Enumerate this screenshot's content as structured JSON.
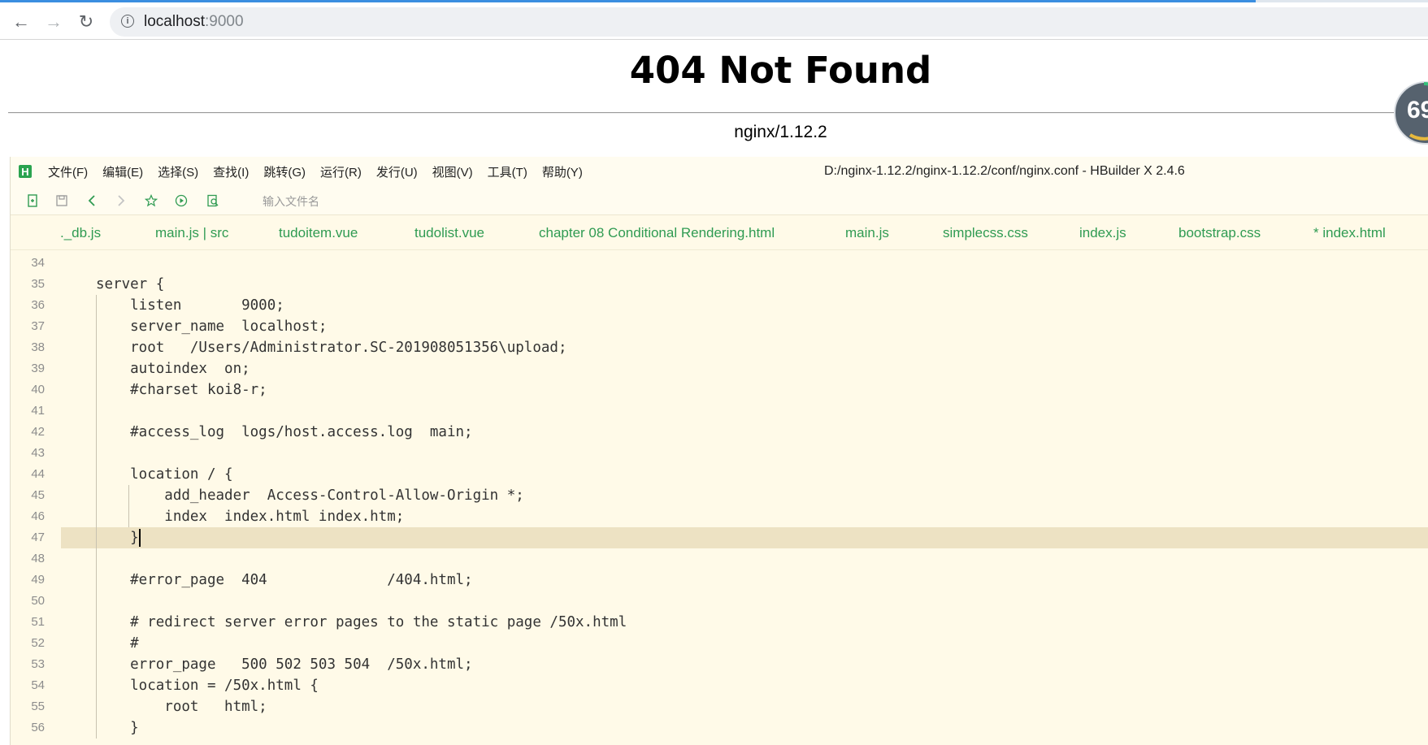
{
  "browser": {
    "url_host": "localhost",
    "url_port": ":9000",
    "back_icon": "←",
    "forward_icon": "→",
    "reload_icon": "↻",
    "info_icon": "i"
  },
  "page": {
    "heading": "404 Not Found",
    "server": "nginx/1.12.2",
    "badge": "69"
  },
  "hbuilder": {
    "logo": "H",
    "title": "D:/nginx-1.12.2/nginx-1.12.2/conf/nginx.conf - HBuilder X 2.4.6",
    "menus": [
      "文件(F)",
      "编辑(E)",
      "选择(S)",
      "查找(I)",
      "跳转(G)",
      "运行(R)",
      "发行(U)",
      "视图(V)",
      "工具(T)",
      "帮助(Y)"
    ],
    "file_placeholder": "输入文件名",
    "tabs": [
      "._db.js",
      "main.js | src",
      "tudoitem.vue",
      "tudolist.vue",
      "chapter 08 Conditional Rendering.html",
      "main.js",
      "simplecss.css",
      "index.js",
      "bootstrap.css",
      "* index.html"
    ],
    "active_line": 47,
    "code_lines": [
      {
        "n": "34",
        "text": ""
      },
      {
        "n": "35",
        "text": "server {"
      },
      {
        "n": "36",
        "text": "    listen       9000;"
      },
      {
        "n": "37",
        "text": "    server_name  localhost;"
      },
      {
        "n": "38",
        "text": "    root   /Users/Administrator.SC-201908051356\\upload;"
      },
      {
        "n": "39",
        "text": "    autoindex  on;"
      },
      {
        "n": "40",
        "text": "    #charset koi8-r;"
      },
      {
        "n": "41",
        "text": ""
      },
      {
        "n": "42",
        "text": "    #access_log  logs/host.access.log  main;"
      },
      {
        "n": "43",
        "text": ""
      },
      {
        "n": "44",
        "text": "    location / {"
      },
      {
        "n": "45",
        "text": "        add_header  Access-Control-Allow-Origin *;"
      },
      {
        "n": "46",
        "text": "        index  index.html index.htm;"
      },
      {
        "n": "47",
        "text": "    }"
      },
      {
        "n": "48",
        "text": ""
      },
      {
        "n": "49",
        "text": "    #error_page  404              /404.html;"
      },
      {
        "n": "50",
        "text": ""
      },
      {
        "n": "51",
        "text": "    # redirect server error pages to the static page /50x.html"
      },
      {
        "n": "52",
        "text": "    #"
      },
      {
        "n": "53",
        "text": "    error_page   500 502 503 504  /50x.html;"
      },
      {
        "n": "54",
        "text": "    location = /50x.html {"
      },
      {
        "n": "55",
        "text": "        root   html;"
      },
      {
        "n": "56",
        "text": "    }"
      }
    ]
  }
}
